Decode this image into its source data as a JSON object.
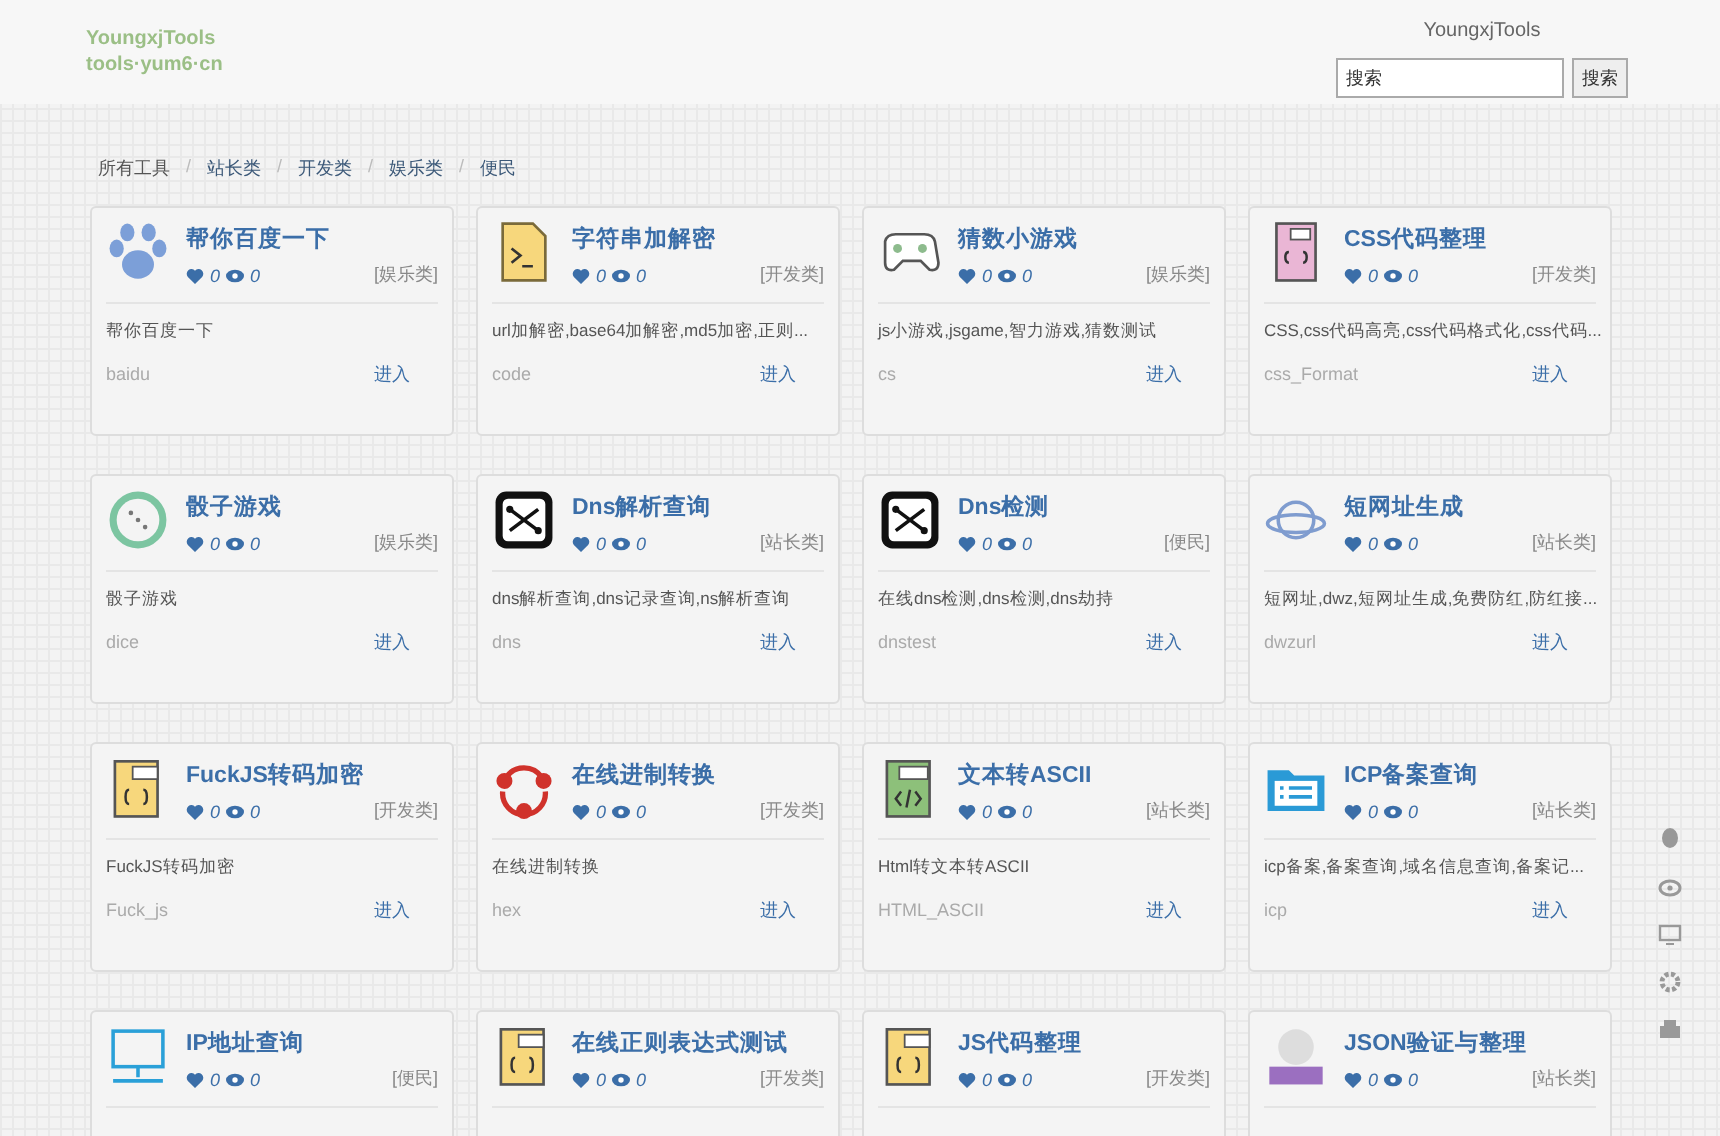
{
  "header": {
    "logo_lines": [
      "YoungxjTools",
      "tools·yum6·cn"
    ],
    "site_name": "YoungxjTools",
    "search": {
      "placeholder": "搜索",
      "button": "搜索"
    }
  },
  "breadcrumb": {
    "separator": "/",
    "items": [
      "所有工具",
      "站长类",
      "开发类",
      "娱乐类",
      "便民"
    ]
  },
  "tools": [
    {
      "title": "帮你百度一下",
      "likes": "0",
      "views": "0",
      "category": "[娱乐类]",
      "description": "帮你百度一下",
      "slug": "baidu",
      "link": "进入"
    },
    {
      "title": "字符串加解密",
      "likes": "0",
      "views": "0",
      "category": "[开发类]",
      "description": "url加解密,base64加解密,md5加密,正则...",
      "slug": "code",
      "link": "进入"
    },
    {
      "title": "猜数小游戏",
      "likes": "0",
      "views": "0",
      "category": "[娱乐类]",
      "description": "js小游戏,jsgame,智力游戏,猜数测试",
      "slug": "cs",
      "link": "进入"
    },
    {
      "title": "CSS代码整理",
      "likes": "0",
      "views": "0",
      "category": "[开发类]",
      "description": "CSS,css代码高亮,css代码格式化,css代码...",
      "slug": "css_Format",
      "link": "进入"
    },
    {
      "title": "骰子游戏",
      "likes": "0",
      "views": "0",
      "category": "[娱乐类]",
      "description": "骰子游戏",
      "slug": "dice",
      "link": "进入"
    },
    {
      "title": "Dns解析查询",
      "likes": "0",
      "views": "0",
      "category": "[站长类]",
      "description": "dns解析查询,dns记录查询,ns解析查询",
      "slug": "dns",
      "link": "进入"
    },
    {
      "title": "Dns检测",
      "likes": "0",
      "views": "0",
      "category": "[便民]",
      "description": "在线dns检测,dns检测,dns劫持",
      "slug": "dnstest",
      "link": "进入"
    },
    {
      "title": "短网址生成",
      "likes": "0",
      "views": "0",
      "category": "[站长类]",
      "description": "短网址,dwz,短网址生成,免费防红,防红接...",
      "slug": "dwzurl",
      "link": "进入"
    },
    {
      "title": "FuckJS转码加密",
      "likes": "0",
      "views": "0",
      "category": "[开发类]",
      "description": "FuckJS转码加密",
      "slug": "Fuck_js",
      "link": "进入"
    },
    {
      "title": "在线进制转换",
      "likes": "0",
      "views": "0",
      "category": "[开发类]",
      "description": "在线进制转换",
      "slug": "hex",
      "link": "进入"
    },
    {
      "title": "文本转ASCII",
      "likes": "0",
      "views": "0",
      "category": "[站长类]",
      "description": "Html转文本转ASCII",
      "slug": "HTML_ASCII",
      "link": "进入"
    },
    {
      "title": "ICP备案查询",
      "likes": "0",
      "views": "0",
      "category": "[站长类]",
      "description": "icp备案,备案查询,域名信息查询,备案记...",
      "slug": "icp",
      "link": "进入"
    },
    {
      "title": "IP地址查询",
      "likes": "0",
      "views": "0",
      "category": "[便民]"
    },
    {
      "title": "在线正则表达式测试",
      "likes": "0",
      "views": "0",
      "category": "[开发类]"
    },
    {
      "title": "JS代码整理",
      "likes": "0",
      "views": "0",
      "category": "[开发类]"
    },
    {
      "title": "JSON验证与整理",
      "likes": "0",
      "views": "0",
      "category": "[站长类]"
    }
  ]
}
